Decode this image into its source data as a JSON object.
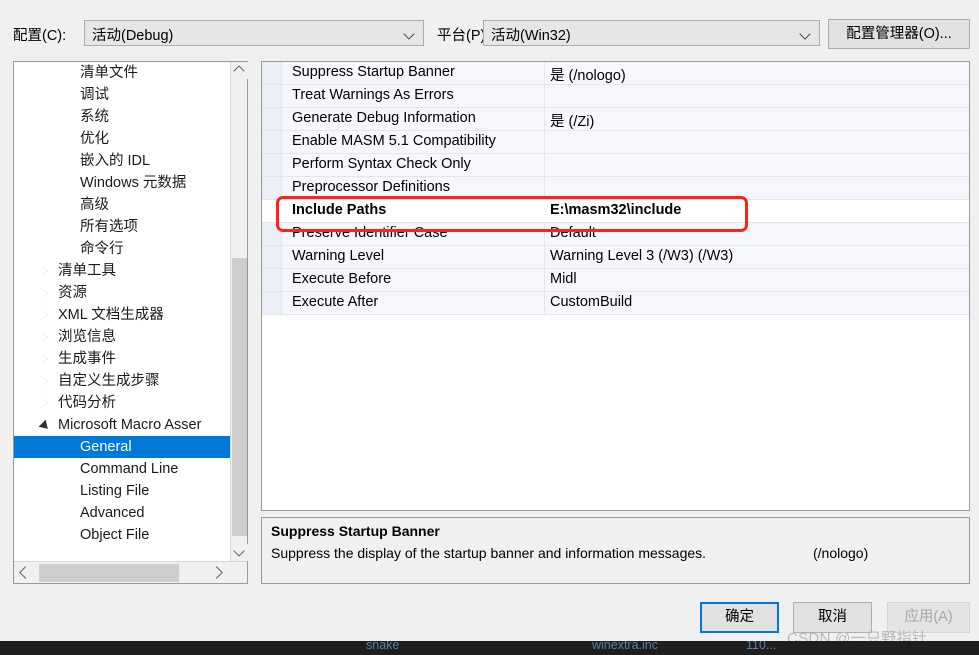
{
  "topbar": {
    "config_label": "配置(C):",
    "config_value": "活动(Debug)",
    "platform_label": "平台(P):",
    "platform_value": "活动(Win32)",
    "config_manager_button": "配置管理器(O)..."
  },
  "tree": {
    "items": [
      {
        "label": "清单文件",
        "level": "child",
        "marker": "none",
        "selected": false
      },
      {
        "label": "调试",
        "level": "child",
        "marker": "none",
        "selected": false
      },
      {
        "label": "系统",
        "level": "child",
        "marker": "none",
        "selected": false
      },
      {
        "label": "优化",
        "level": "child",
        "marker": "none",
        "selected": false
      },
      {
        "label": "嵌入的 IDL",
        "level": "child",
        "marker": "none",
        "selected": false
      },
      {
        "label": "Windows 元数据",
        "level": "child",
        "marker": "none",
        "selected": false
      },
      {
        "label": "高级",
        "level": "child",
        "marker": "none",
        "selected": false
      },
      {
        "label": "所有选项",
        "level": "child",
        "marker": "none",
        "selected": false
      },
      {
        "label": "命令行",
        "level": "child",
        "marker": "none",
        "selected": false
      },
      {
        "label": "清单工具",
        "level": "top",
        "marker": "collapsed",
        "selected": false
      },
      {
        "label": "资源",
        "level": "top",
        "marker": "collapsed",
        "selected": false
      },
      {
        "label": "XML 文档生成器",
        "level": "top",
        "marker": "collapsed",
        "selected": false
      },
      {
        "label": "浏览信息",
        "level": "top",
        "marker": "collapsed",
        "selected": false
      },
      {
        "label": "生成事件",
        "level": "top",
        "marker": "collapsed",
        "selected": false
      },
      {
        "label": "自定义生成步骤",
        "level": "top",
        "marker": "collapsed",
        "selected": false
      },
      {
        "label": "代码分析",
        "level": "top",
        "marker": "collapsed",
        "selected": false
      },
      {
        "label": "Microsoft Macro Asser",
        "level": "top",
        "marker": "expanded",
        "selected": false
      },
      {
        "label": "General",
        "level": "sub",
        "marker": "none",
        "selected": true
      },
      {
        "label": "Command Line",
        "level": "sub",
        "marker": "none",
        "selected": false
      },
      {
        "label": "Listing File",
        "level": "sub",
        "marker": "none",
        "selected": false
      },
      {
        "label": "Advanced",
        "level": "sub",
        "marker": "none",
        "selected": false
      },
      {
        "label": "Object File",
        "level": "sub",
        "marker": "none",
        "selected": false
      }
    ]
  },
  "grid": {
    "rows": [
      {
        "name": "Suppress Startup Banner",
        "value": "是 (/nologo)",
        "highlighted": false
      },
      {
        "name": "Treat Warnings As Errors",
        "value": "",
        "highlighted": false
      },
      {
        "name": "Generate Debug Information",
        "value": "是 (/Zi)",
        "highlighted": false
      },
      {
        "name": "Enable MASM 5.1 Compatibility",
        "value": "",
        "highlighted": false
      },
      {
        "name": "Perform Syntax Check Only",
        "value": "",
        "highlighted": false
      },
      {
        "name": "Preprocessor Definitions",
        "value": "",
        "highlighted": false
      },
      {
        "name": "Include Paths",
        "value": "E:\\masm32\\include",
        "highlighted": true
      },
      {
        "name": "Preserve Identifier Case",
        "value": "Default",
        "highlighted": false
      },
      {
        "name": "Warning Level",
        "value": "Warning Level 3 (/W3) (/W3)",
        "highlighted": false
      },
      {
        "name": "Execute Before",
        "value": "Midl",
        "highlighted": false
      },
      {
        "name": "Execute After",
        "value": "CustomBuild",
        "highlighted": false
      }
    ],
    "highlight_color": "#fb2417",
    "selection_color": "#0078d7"
  },
  "description": {
    "title": "Suppress Startup Banner",
    "body": "Suppress the display of the startup banner and information messages.",
    "flag": "(/nologo)"
  },
  "footer": {
    "ok_button": "确定",
    "cancel_button": "取消",
    "apply_button": "应用(A)",
    "watermark": "CSDN @一只野指针."
  },
  "bottom_strip": {
    "item1": "snake",
    "item2": "winextra.inc",
    "item3": "110..."
  }
}
